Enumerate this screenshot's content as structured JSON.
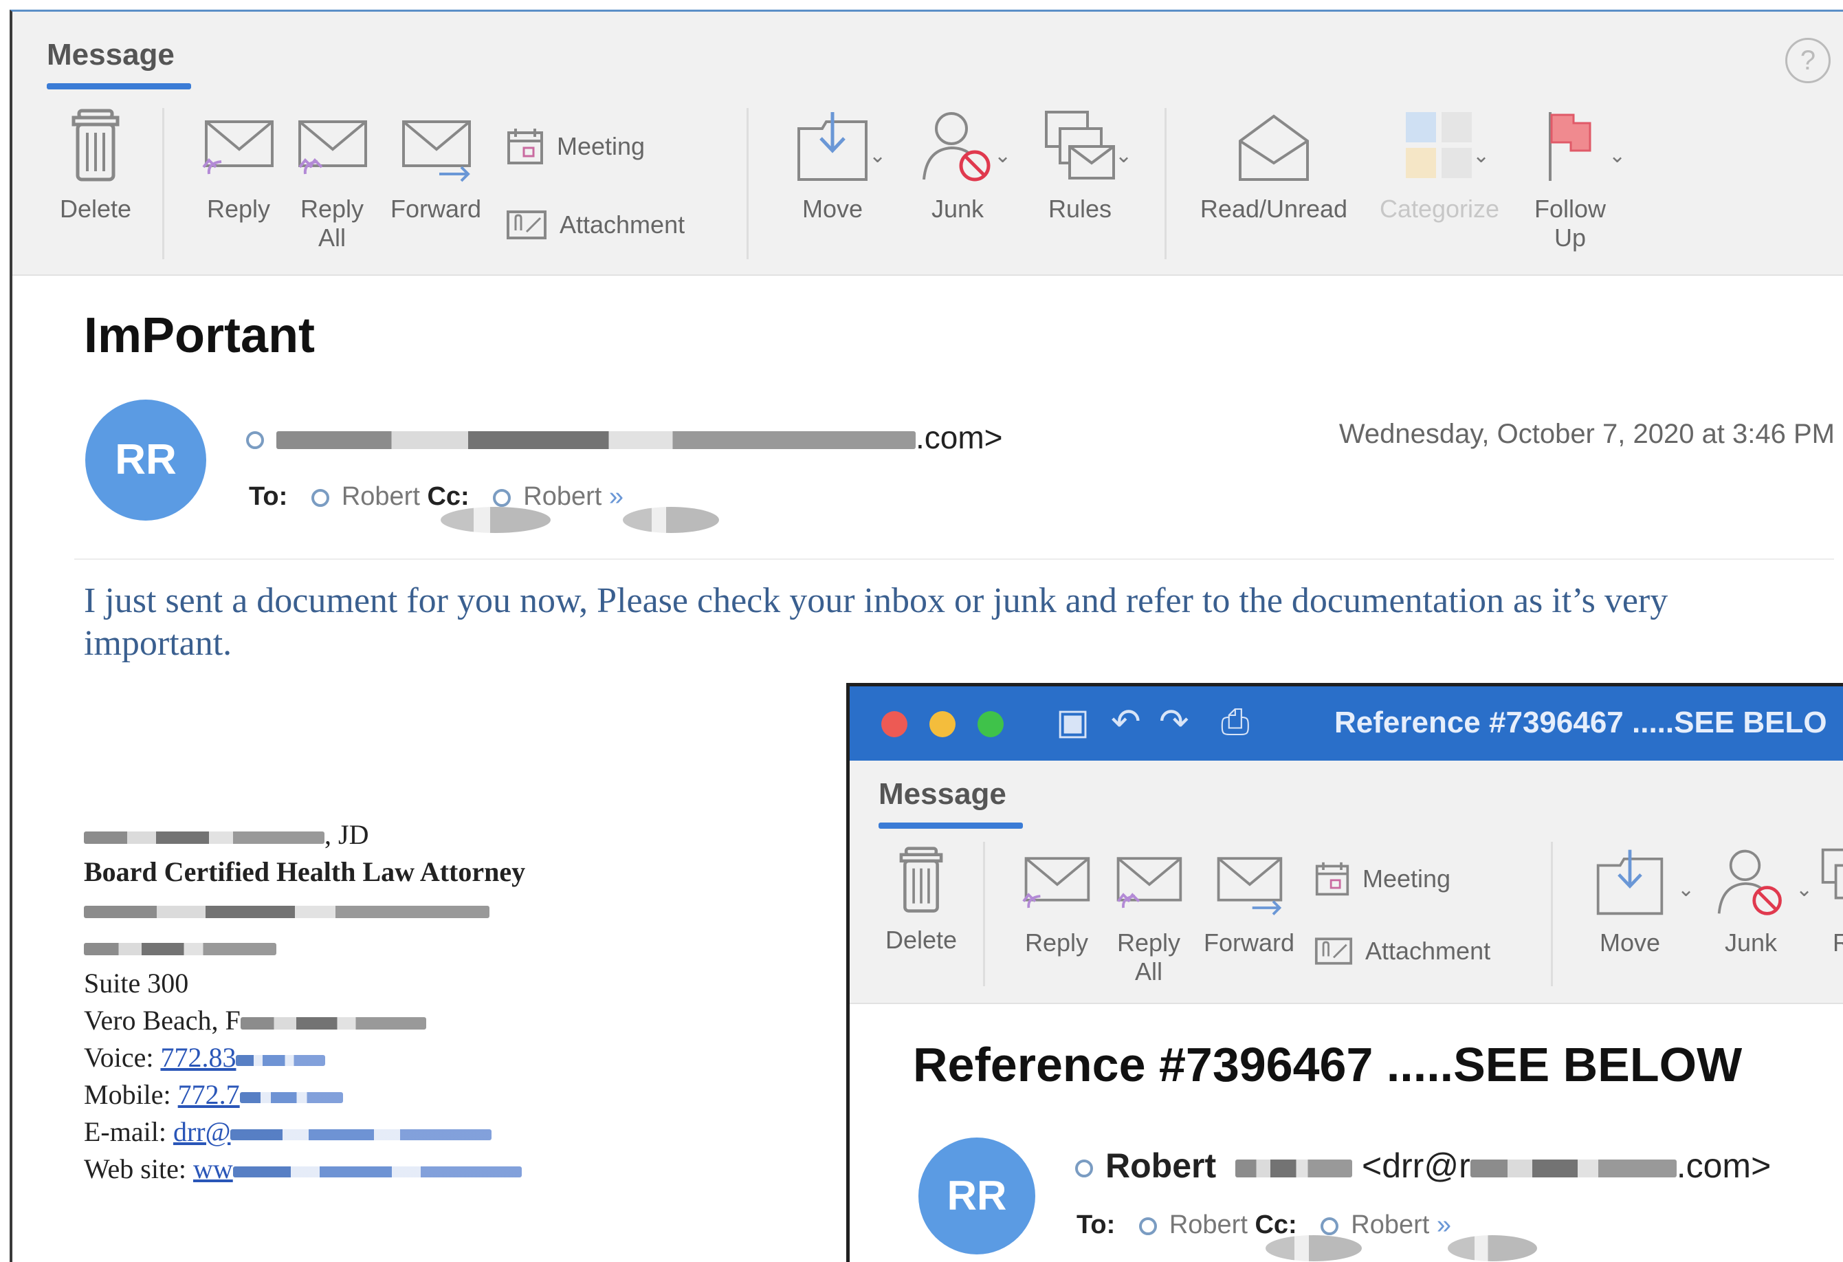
{
  "ribbon": {
    "tab": "Message",
    "buttons": {
      "delete": "Delete",
      "reply": "Reply",
      "reply_all_1": "Reply",
      "reply_all_2": "All",
      "forward": "Forward",
      "meeting": "Meeting",
      "attachment": "Attachment",
      "move": "Move",
      "junk": "Junk",
      "rules": "Rules",
      "read_unread": "Read/Unread",
      "categorize": "Categorize",
      "follow_up_1": "Follow",
      "follow_up_2": "Up"
    },
    "help": "?"
  },
  "email": {
    "subject": "ImPortant",
    "avatar_initials": "RR",
    "sender_tail": ".com>",
    "date": "Wednesday, October 7, 2020 at 3:46 PM",
    "to_label": "To:",
    "to_name": "Robert",
    "cc_label": "Cc:",
    "cc_name": "Robert",
    "expand": "»",
    "body": "I just sent a document for you now, Please check your inbox or junk and refer to the documentation as it’s very important.",
    "signature": {
      "name_suffix": ", JD",
      "title": "Board Certified Health Law Attorney",
      "suite": "Suite 300",
      "city": "Vero Beach, F",
      "voice_label": "Voice: ",
      "voice": "772.83",
      "mobile_label": "Mobile: ",
      "mobile": "772.7",
      "email_label": "E-mail: ",
      "email": "drr@",
      "web_label": "Web site: ",
      "web": "ww"
    }
  },
  "inset": {
    "window_title": "Reference #7396467  .....SEE BELO",
    "tab": "Message",
    "buttons": {
      "delete": "Delete",
      "reply": "Reply",
      "reply_all_1": "Reply",
      "reply_all_2": "All",
      "forward": "Forward",
      "meeting": "Meeting",
      "attachment": "Attachment",
      "move": "Move",
      "junk": "Junk",
      "rules_partial": "R"
    },
    "subject": "Reference #7396467  .....SEE BELOW",
    "avatar_initials": "RR",
    "sender_name": "Robert",
    "sender_mid": "<drr@r",
    "sender_tail": ".com>",
    "to_label": "To:",
    "to_name": "Robert",
    "cc_label": "Cc:",
    "cc_name": "Robert",
    "expand": "»"
  },
  "colors": {
    "accent": "#3b7cd6",
    "avatar": "#5b9be3",
    "titlebar": "#2a6fc9",
    "body_text": "#3a5f8f",
    "link": "#2a56b8"
  }
}
